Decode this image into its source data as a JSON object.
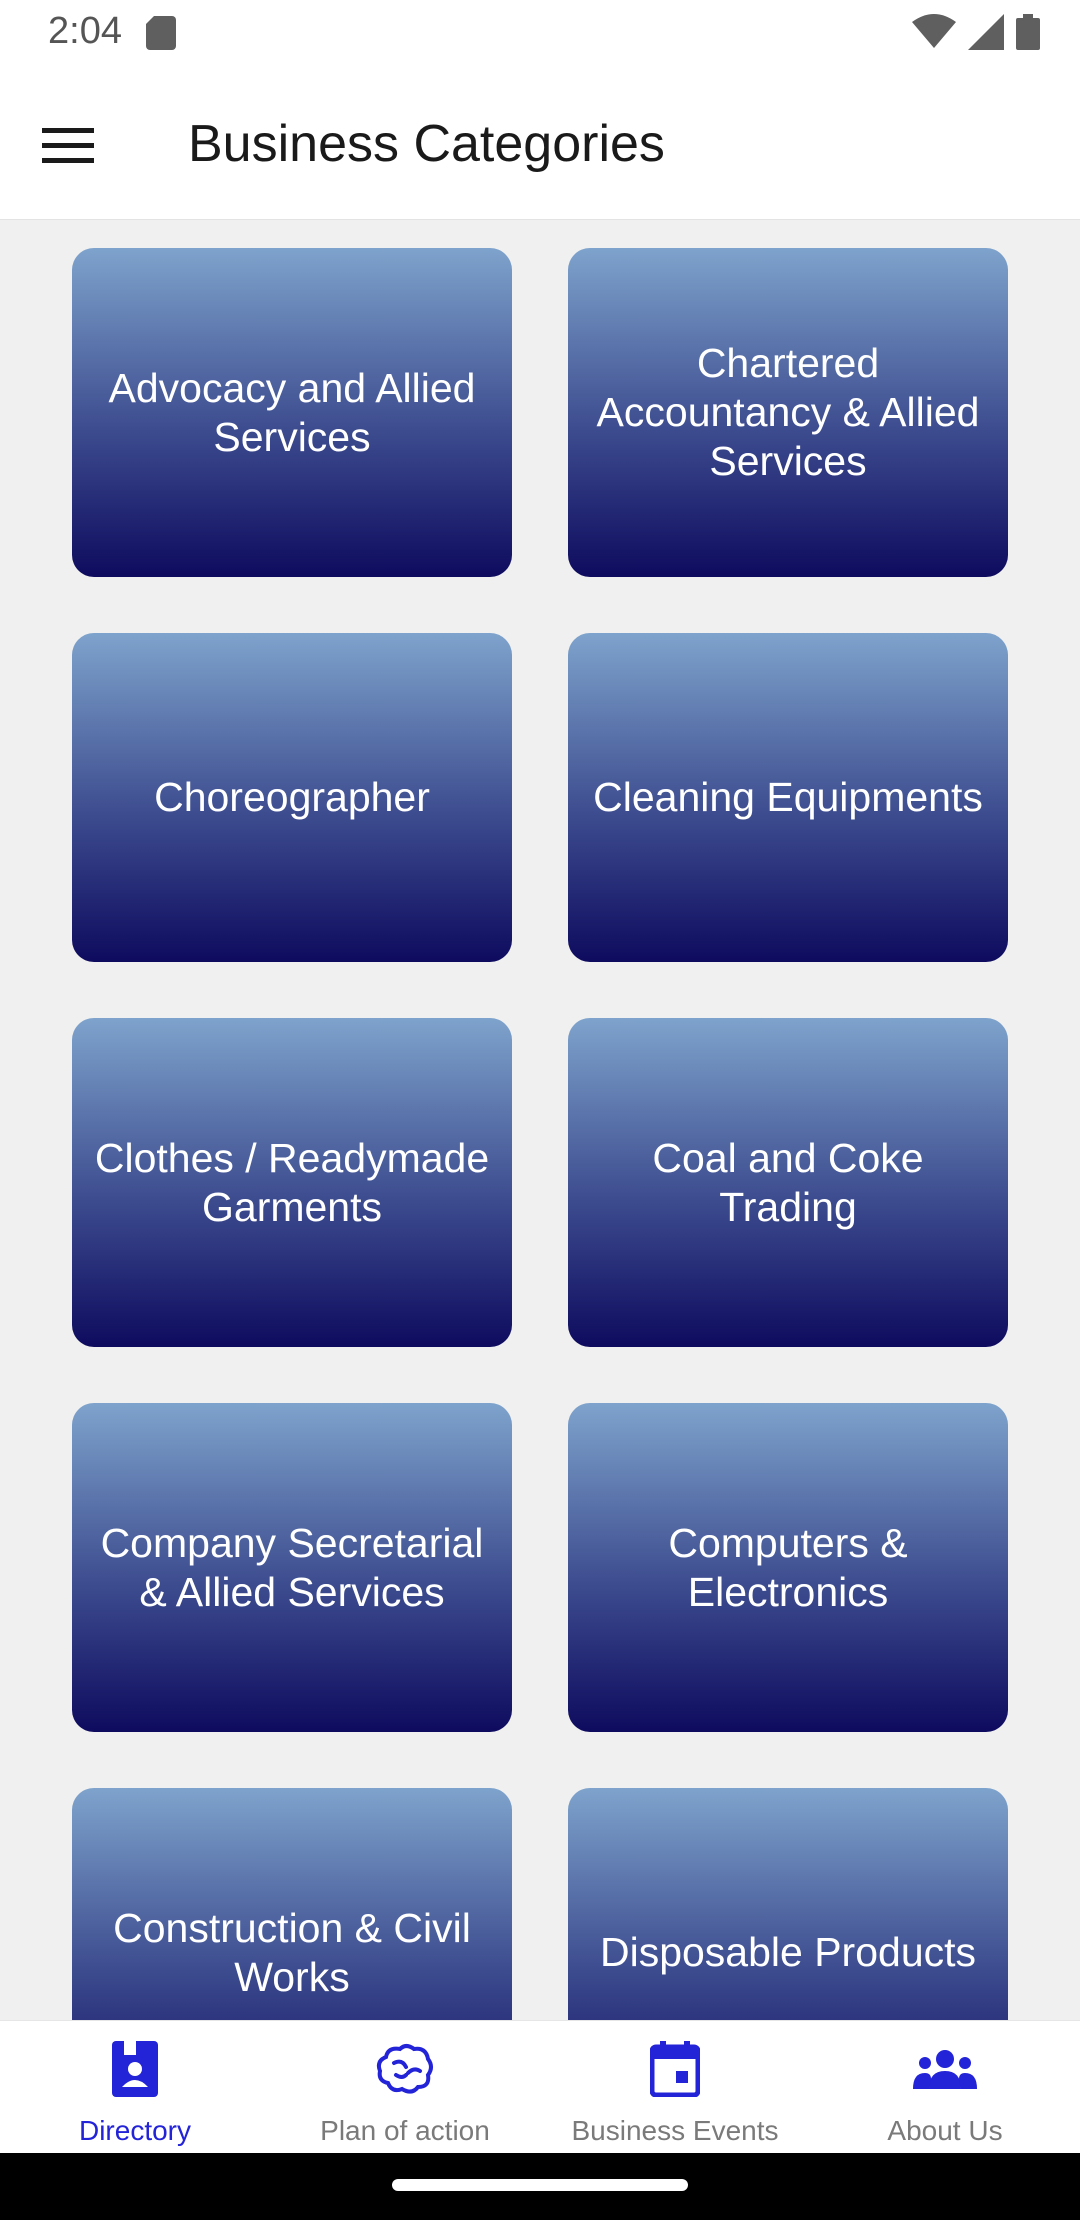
{
  "status": {
    "time": "2:04"
  },
  "header": {
    "title": "Business Categories"
  },
  "categories": [
    "Advocacy and Allied Services",
    "Chartered Accountancy & Allied Services",
    "Choreographer",
    "Cleaning Equipments",
    "Clothes / Readymade Garments",
    "Coal and Coke Trading",
    "Company Secretarial & Allied Services",
    "Computers & Electronics",
    "Construction & Civil Works",
    "Disposable Products"
  ],
  "nav": {
    "directory": "Directory",
    "plan": "Plan of action",
    "events": "Business Events",
    "about": "About Us"
  },
  "colors": {
    "accent": "#2323d8",
    "card_top": "#7ea3cc",
    "card_bottom": "#0e0b5e"
  }
}
